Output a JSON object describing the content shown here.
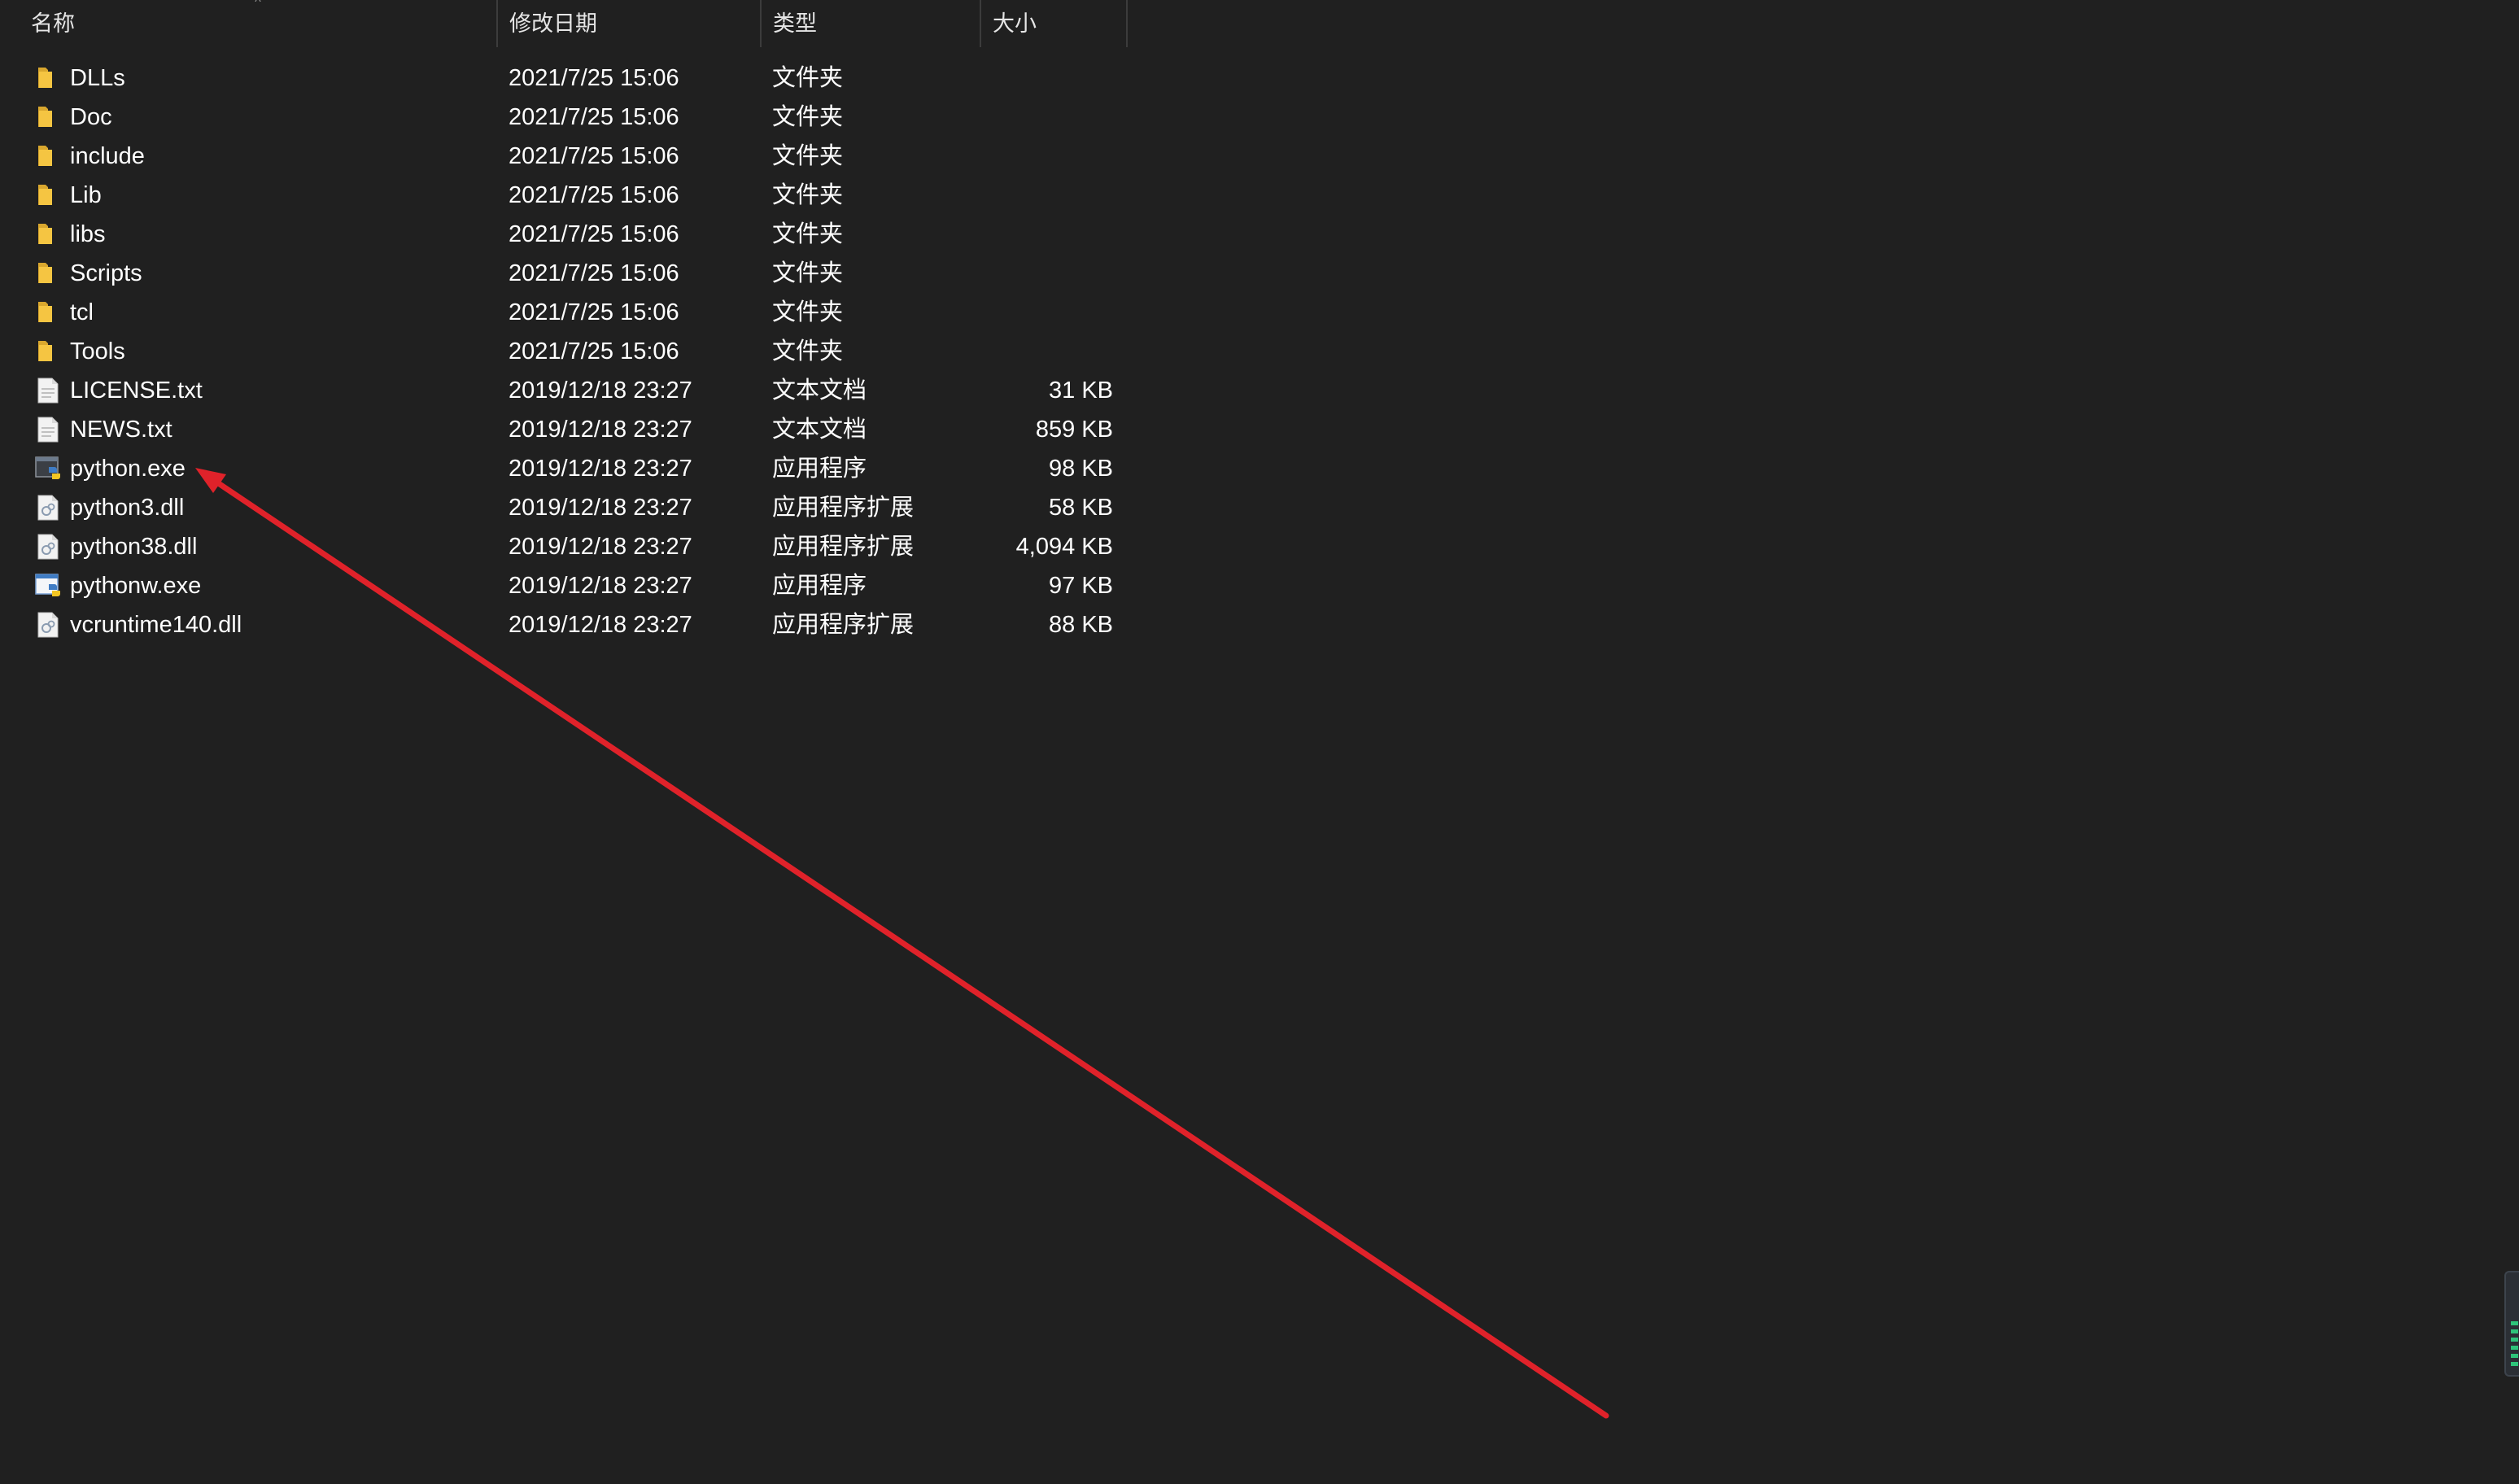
{
  "header": {
    "col_name": "名称",
    "col_date": "修改日期",
    "col_type": "类型",
    "col_size": "大小",
    "sort_indicator": "^"
  },
  "colors": {
    "background": "#202020",
    "folder": "#f5c542",
    "arrow": "#e0222a"
  },
  "files": [
    {
      "name": "DLLs",
      "date": "2021/7/25 15:06",
      "type": "文件夹",
      "size": "",
      "icon": "folder-icon"
    },
    {
      "name": "Doc",
      "date": "2021/7/25 15:06",
      "type": "文件夹",
      "size": "",
      "icon": "folder-icon"
    },
    {
      "name": "include",
      "date": "2021/7/25 15:06",
      "type": "文件夹",
      "size": "",
      "icon": "folder-icon"
    },
    {
      "name": "Lib",
      "date": "2021/7/25 15:06",
      "type": "文件夹",
      "size": "",
      "icon": "folder-icon"
    },
    {
      "name": "libs",
      "date": "2021/7/25 15:06",
      "type": "文件夹",
      "size": "",
      "icon": "folder-icon"
    },
    {
      "name": "Scripts",
      "date": "2021/7/25 15:06",
      "type": "文件夹",
      "size": "",
      "icon": "folder-icon"
    },
    {
      "name": "tcl",
      "date": "2021/7/25 15:06",
      "type": "文件夹",
      "size": "",
      "icon": "folder-icon"
    },
    {
      "name": "Tools",
      "date": "2021/7/25 15:06",
      "type": "文件夹",
      "size": "",
      "icon": "folder-icon"
    },
    {
      "name": "LICENSE.txt",
      "date": "2019/12/18 23:27",
      "type": "文本文档",
      "size": "31 KB",
      "icon": "text-file-icon"
    },
    {
      "name": "NEWS.txt",
      "date": "2019/12/18 23:27",
      "type": "文本文档",
      "size": "859 KB",
      "icon": "text-file-icon"
    },
    {
      "name": "python.exe",
      "date": "2019/12/18 23:27",
      "type": "应用程序",
      "size": "98 KB",
      "icon": "python-exe-icon"
    },
    {
      "name": "python3.dll",
      "date": "2019/12/18 23:27",
      "type": "应用程序扩展",
      "size": "58 KB",
      "icon": "dll-file-icon"
    },
    {
      "name": "python38.dll",
      "date": "2019/12/18 23:27",
      "type": "应用程序扩展",
      "size": "4,094 KB",
      "icon": "dll-file-icon"
    },
    {
      "name": "pythonw.exe",
      "date": "2019/12/18 23:27",
      "type": "应用程序",
      "size": "97 KB",
      "icon": "pythonw-exe-icon"
    },
    {
      "name": "vcruntime140.dll",
      "date": "2019/12/18 23:27",
      "type": "应用程序扩展",
      "size": "88 KB",
      "icon": "dll-file-icon"
    }
  ]
}
